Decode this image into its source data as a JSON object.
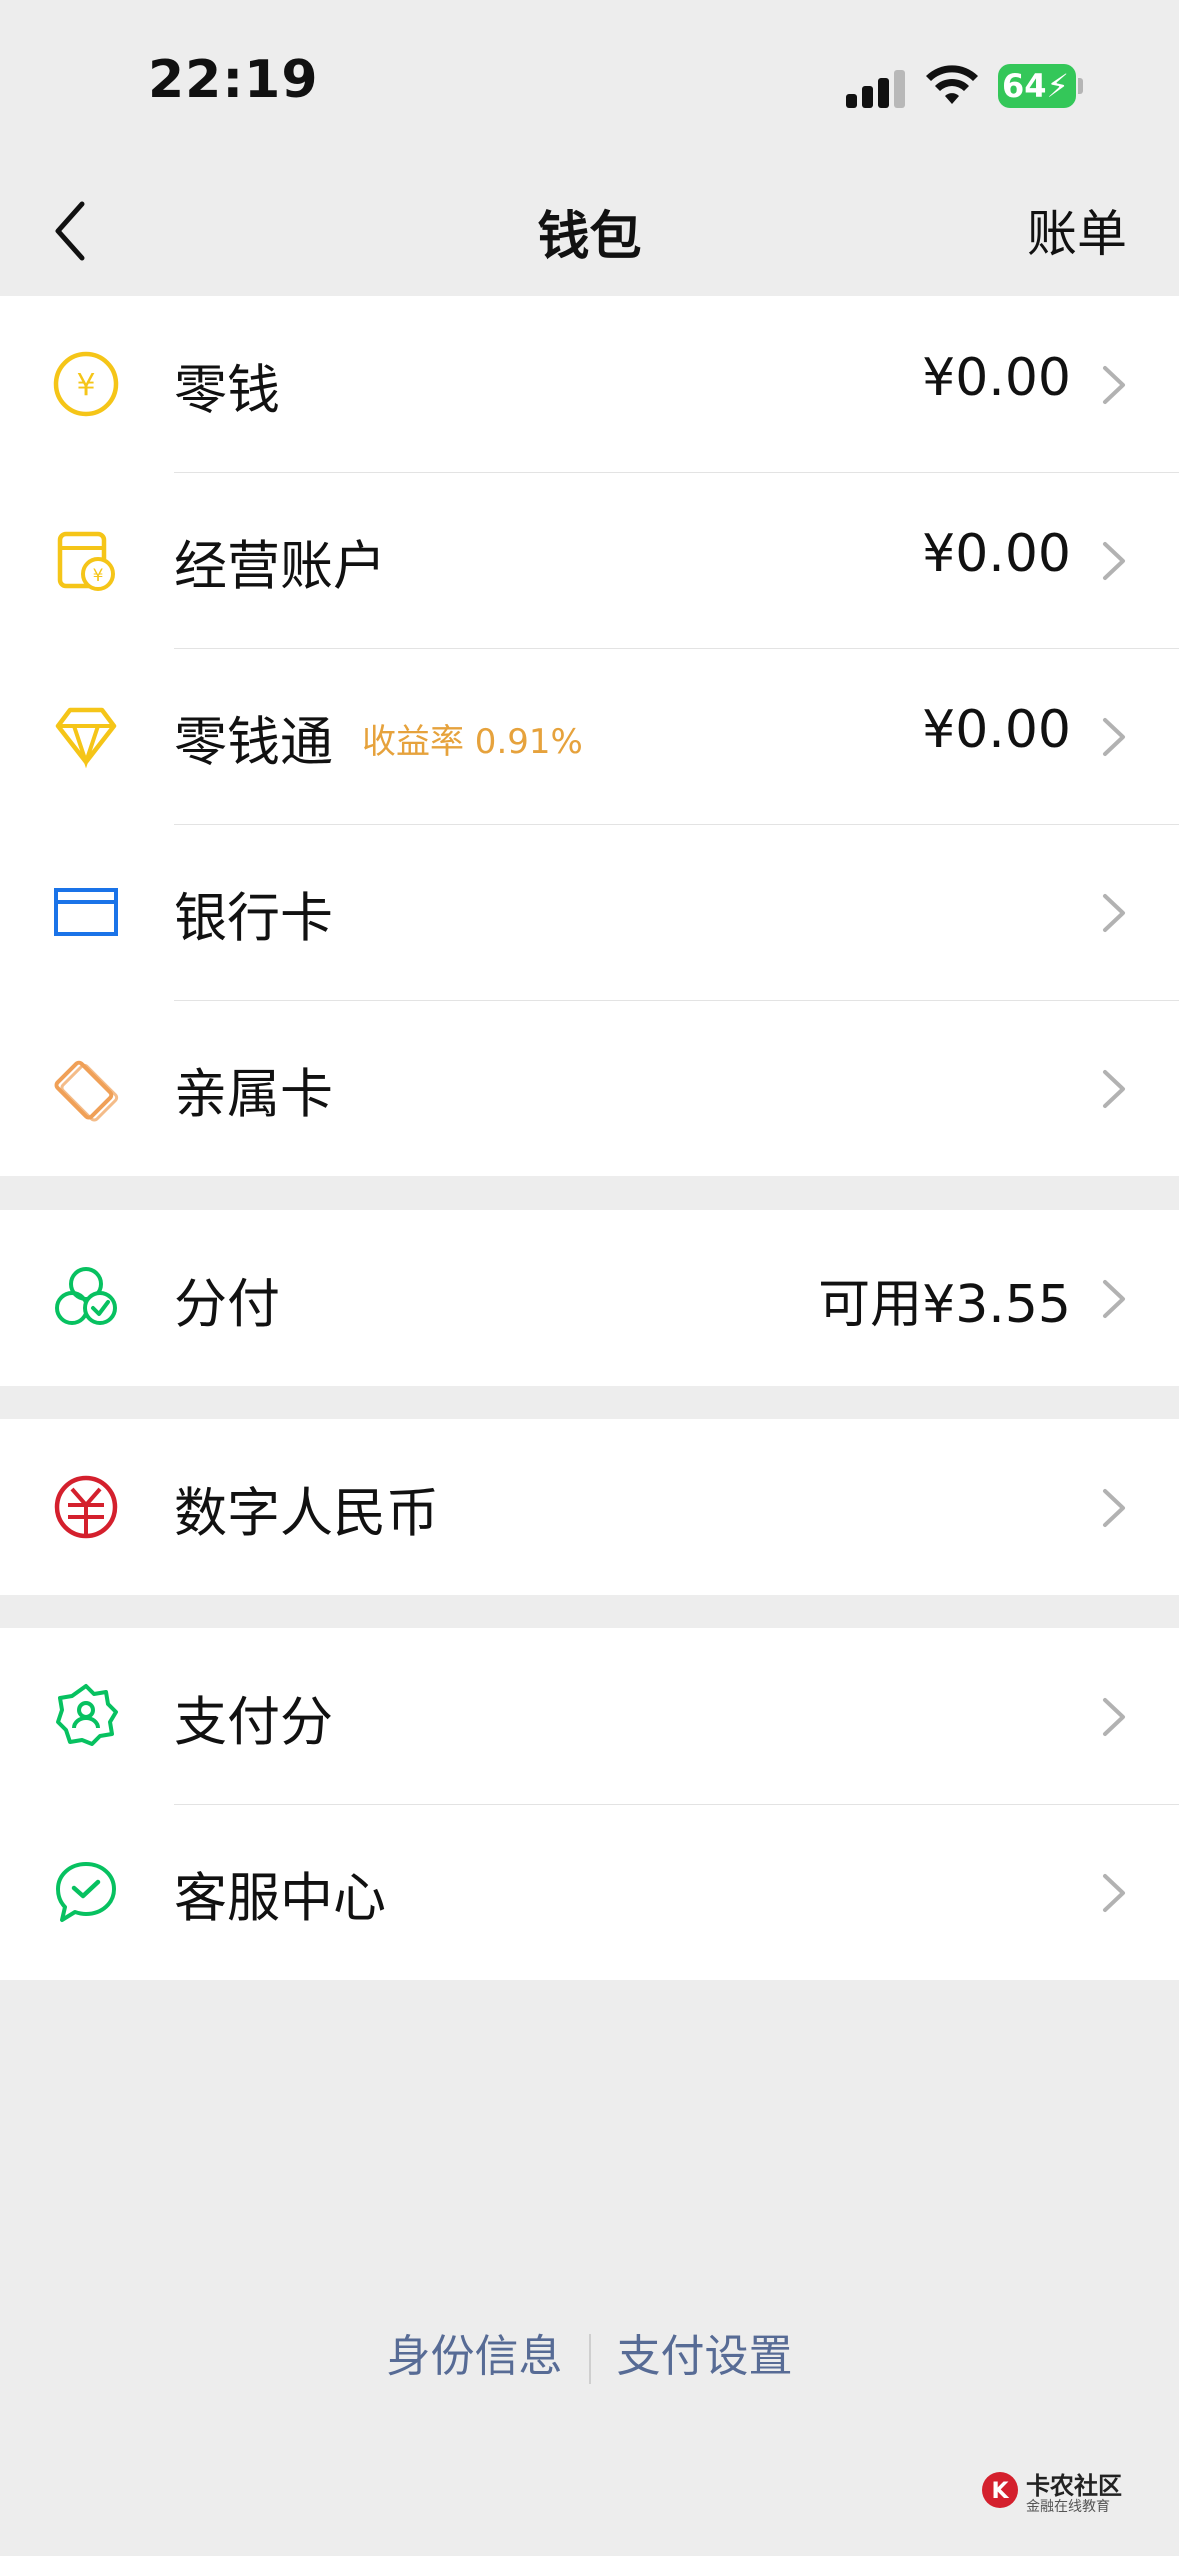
{
  "status_bar": {
    "time": "22:19",
    "battery_level": "64"
  },
  "nav": {
    "title": "钱包",
    "right_label": "账单"
  },
  "groups": [
    {
      "items": [
        {
          "label": "零钱",
          "value": "¥0.00",
          "icon": "coin-yen-icon"
        },
        {
          "label": "经营账户",
          "value": "¥0.00",
          "icon": "shop-account-icon"
        },
        {
          "label": "零钱通",
          "tag": "收益率 0.91%",
          "value": "¥0.00",
          "icon": "diamond-icon"
        },
        {
          "label": "银行卡",
          "icon": "bank-card-icon"
        },
        {
          "label": "亲属卡",
          "icon": "family-card-icon"
        }
      ]
    },
    {
      "items": [
        {
          "label": "分付",
          "value": "可用¥3.55",
          "icon": "fenfu-icon"
        }
      ]
    },
    {
      "items": [
        {
          "label": "数字人民币",
          "icon": "digital-rmb-icon"
        }
      ]
    },
    {
      "items": [
        {
          "label": "支付分",
          "icon": "pay-score-icon"
        },
        {
          "label": "客服中心",
          "icon": "customer-service-icon"
        }
      ]
    }
  ],
  "footer": {
    "identity_label": "身份信息",
    "settings_label": "支付设置"
  },
  "watermark": {
    "title": "卡农社区",
    "subtitle": "金融在线教育"
  },
  "colors": {
    "accent_yellow": "#f5c518",
    "accent_orange": "#e6a23c",
    "accent_blue": "#1a73e8",
    "accent_green": "#07c160",
    "accent_red": "#d4202d",
    "link": "#576b95"
  }
}
